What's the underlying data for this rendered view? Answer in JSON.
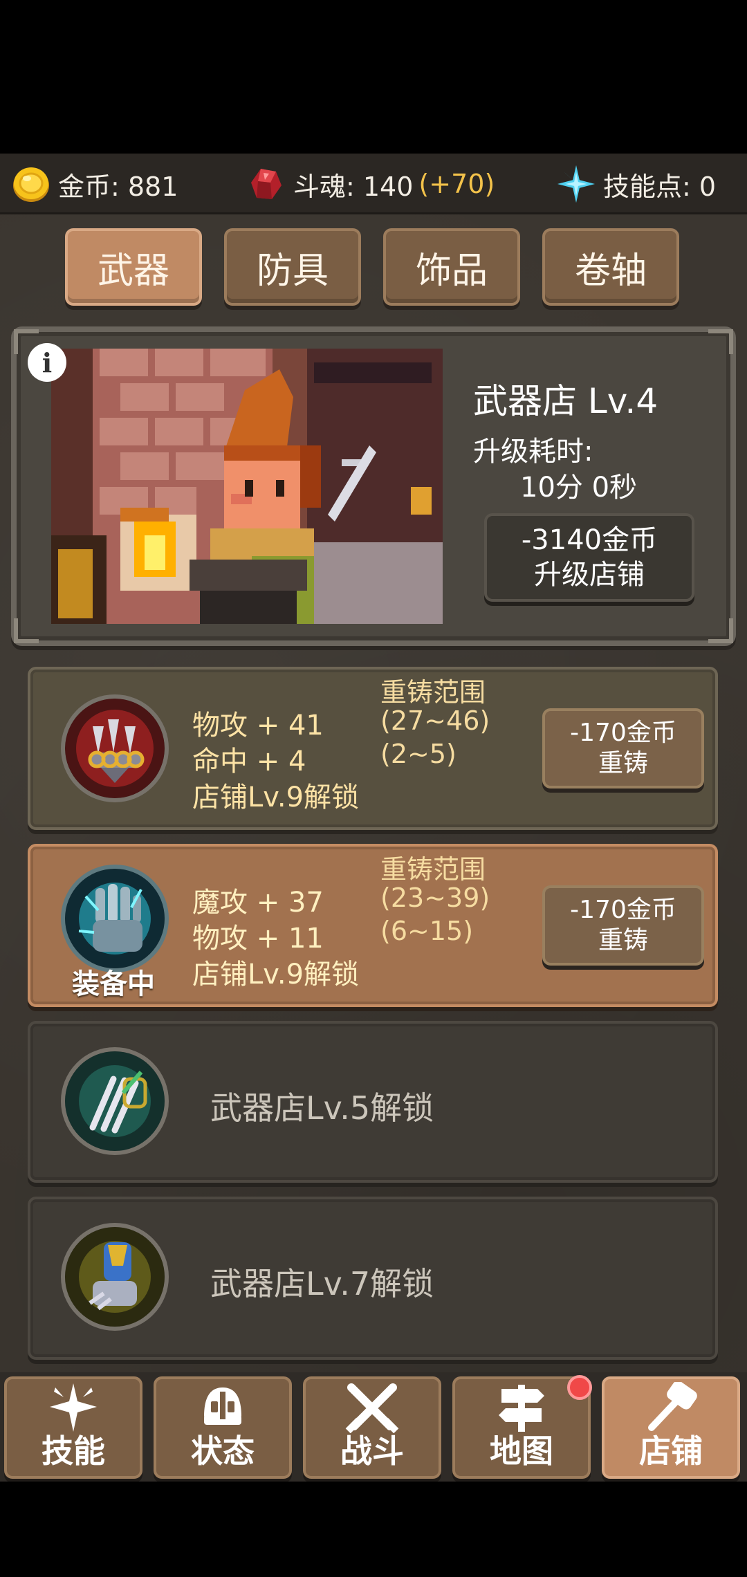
{
  "resources": {
    "gold_label": "金币: 881",
    "soul_label": "斗魂: 140",
    "soul_bonus": "(+70)",
    "skill_label": "技能点: 0"
  },
  "tabs": [
    {
      "label": "武器",
      "active": true
    },
    {
      "label": "防具"
    },
    {
      "label": "饰品"
    },
    {
      "label": "卷轴"
    }
  ],
  "shop": {
    "title": "武器店 Lv.4",
    "time_label": "升级耗时:",
    "time_value": "10分 0秒",
    "upgrade_cost": "-3140金币",
    "upgrade_label": "升级店铺",
    "info_icon": "info-icon"
  },
  "items": [
    {
      "icon": "claw-knuckle-icon",
      "stats": [
        "物攻 + 41",
        "命中 + 4",
        "店铺Lv.9解锁"
      ],
      "range_title": "重铸范围",
      "ranges": [
        "(27~46)",
        "(2~5)"
      ],
      "cost": "-170金币",
      "action": "重铸"
    },
    {
      "icon": "frost-gauntlet-icon",
      "equipped_label": "装备中",
      "stats": [
        "魔攻 + 37",
        "物攻 + 11",
        "店铺Lv.9解锁"
      ],
      "range_title": "重铸范围",
      "ranges": [
        "(23~39)",
        "(6~15)"
      ],
      "cost": "-170金币",
      "action": "重铸"
    },
    {
      "icon": "green-claw-icon",
      "lock_text": "武器店Lv.5解锁"
    },
    {
      "icon": "gold-gauntlet-icon",
      "lock_text": "武器店Lv.7解锁"
    }
  ],
  "nav": [
    {
      "label": "技能",
      "icon": "sparkle-icon"
    },
    {
      "label": "状态",
      "icon": "helmet-icon"
    },
    {
      "label": "战斗",
      "icon": "crossed-swords-icon"
    },
    {
      "label": "地图",
      "icon": "signpost-icon",
      "badge": true
    },
    {
      "label": "店铺",
      "icon": "hammer-icon",
      "active": true
    }
  ],
  "colors": {
    "accent_gold": "#f3c24a",
    "tab_active": "#c08a64",
    "tab_normal": "#7a5e44",
    "badge_red": "#f04848"
  }
}
